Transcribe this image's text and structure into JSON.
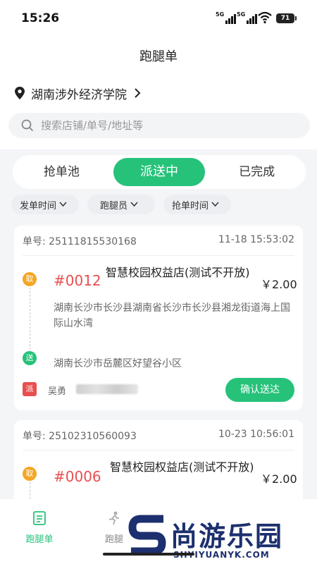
{
  "status": {
    "time": "15:26",
    "signal1": "5G",
    "signal2": "5G",
    "battery": "71"
  },
  "header": {
    "title": "跑腿单"
  },
  "location": {
    "name": "湖南涉外经济学院"
  },
  "search": {
    "placeholder": "搜索店铺/单号/地址等"
  },
  "tabs": [
    {
      "label": "抢单池"
    },
    {
      "label": "派送中"
    },
    {
      "label": "已完成"
    }
  ],
  "filters": [
    {
      "label": "发单时间"
    },
    {
      "label": "跑腿员"
    },
    {
      "label": "抢单时间"
    }
  ],
  "orders": [
    {
      "label": "单号:",
      "id": "25111815530168",
      "time": "11-18 15:53:02",
      "pickup_badge": "取",
      "number": "#0012",
      "shop": "智慧校园权益店(测试不开放)",
      "price": "￥2.00",
      "pickup_address": "湖南长沙市长沙县湖南省长沙市长沙县湘龙街道海上国际山水湾",
      "deliver_badge": "送",
      "deliver_address": "湖南长沙市岳麓区好望谷小区",
      "rider_badge": "派",
      "rider_name": "吴勇",
      "action": "确认送达"
    },
    {
      "label": "单号:",
      "id": "25102310560093",
      "time": "10-23 10:56:01",
      "pickup_badge": "取",
      "number": "#0006",
      "shop": "智慧校园权益店(测试不开放)",
      "price": "￥2.00"
    }
  ],
  "bottom_nav": [
    {
      "label": "跑腿单"
    },
    {
      "label": "跑腿"
    }
  ],
  "watermark": {
    "cn": "尚游乐园",
    "en": "SHYIYUANYK.COM"
  },
  "colors": {
    "accent": "#26c27a",
    "order_number": "#e94f4f",
    "pickup": "#f5a623",
    "dispatch": "#e94f4f"
  }
}
